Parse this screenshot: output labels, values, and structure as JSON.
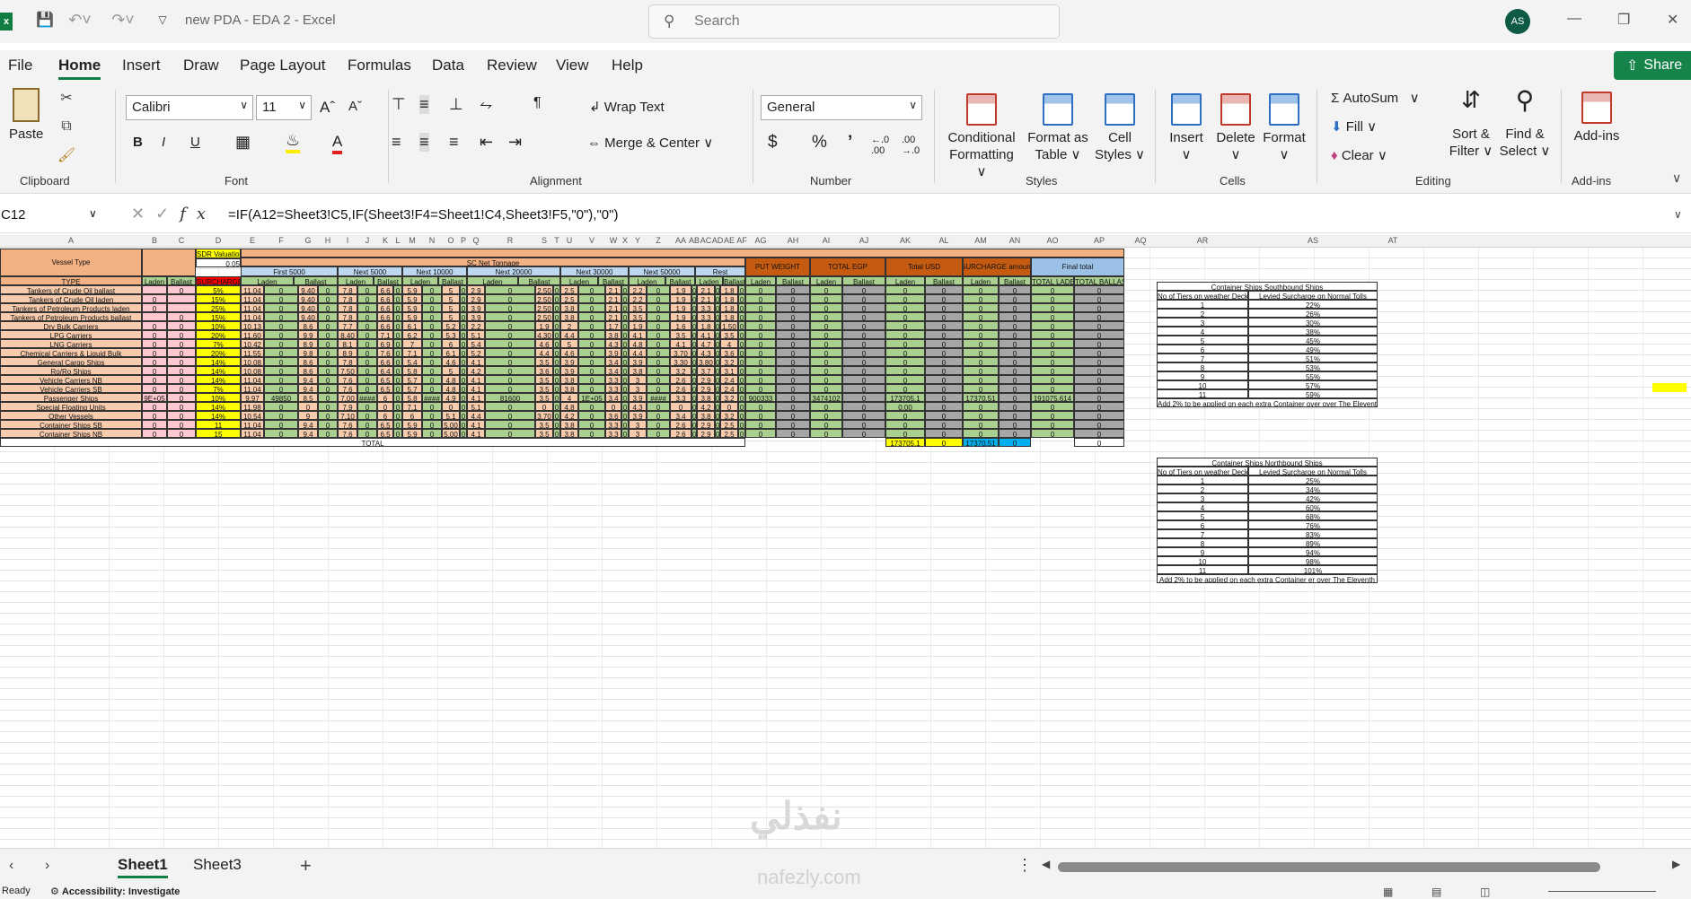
{
  "titlebar": {
    "autosave_label": "",
    "doc_title": "new PDA - EDA 2  -  Excel",
    "search_placeholder": "Search",
    "avatar": "AS"
  },
  "ribbon_tabs": [
    "File",
    "Home",
    "Insert",
    "Draw",
    "Page Layout",
    "Formulas",
    "Data",
    "Review",
    "View",
    "Help"
  ],
  "share_label": "Share",
  "clipboard": {
    "paste": "Paste",
    "group": "Clipboard"
  },
  "font": {
    "name": "Calibri",
    "size": "11",
    "group": "Font",
    "bold": "B",
    "italic": "I",
    "underline": "U"
  },
  "alignment": {
    "wrap": "Wrap Text",
    "merge": "Merge & Center",
    "group": "Alignment"
  },
  "number": {
    "format": "General",
    "group": "Number",
    "currency": "$",
    "percent": "%",
    "comma": "’"
  },
  "styles": {
    "cond": [
      "Conditional",
      "Formatting"
    ],
    "table": [
      "Format as",
      "Table"
    ],
    "cell": [
      "Cell",
      "Styles"
    ],
    "group": "Styles"
  },
  "cells": {
    "insert": "Insert",
    "delete": "Delete",
    "format": "Format",
    "group": "Cells"
  },
  "editing": {
    "autosum": "AutoSum",
    "fill": "Fill",
    "clear": "Clear",
    "sort": [
      "Sort &",
      "Filter"
    ],
    "find": [
      "Find &",
      "Select"
    ],
    "group": "Editing"
  },
  "addins": {
    "label": "Add-ins",
    "group": "Add-ins"
  },
  "formula_bar": {
    "cell_ref": "C12",
    "formula": "=IF(A12=Sheet3!C5,IF(Sheet3!F4=Sheet1!C4,Sheet3!F5,\"0\"),\"0\")"
  },
  "columns": [
    "A",
    "B",
    "C",
    "D",
    "E",
    "F",
    "G",
    "H",
    "I",
    "J",
    "K",
    "L",
    "M",
    "N",
    "O",
    "P",
    "Q",
    "R",
    "S",
    "T",
    "U",
    "V",
    "W",
    "X",
    "Y",
    "Z",
    "AA",
    "AB",
    "AC",
    "AD",
    "AE",
    "AF",
    "AG",
    "AH",
    "AI",
    "AJ",
    "AK",
    "AL",
    "AM",
    "AN",
    "AO",
    "AP",
    "AQ",
    "AR",
    "AS",
    "AT"
  ],
  "sheet": {
    "vessel_type": "Vessel Type",
    "sdr_label": "SDR Valuation",
    "sdr_value": "0.05",
    "sc_net": "SC Net Tonnage",
    "bands": [
      "First 5000",
      "Next 5000",
      "Next 10000",
      "Next 20000",
      "Next 30000",
      "Next 50000",
      "Rest"
    ],
    "right_heads": [
      "PUT WEIGHT",
      "TOTAL EGP",
      "Total USD",
      "SURCHARGE amount",
      "Final total"
    ],
    "type": "TYPE",
    "laden": "Laden",
    "ballast": "Ballast",
    "surcharge": "SURCHARGE",
    "total_laden": "TOTAL LADEN",
    "total_ballast": "TOTAL BALLAST",
    "total": "TOTAL",
    "rows": [
      {
        "name": "Tankers of Crude Oil ballast",
        "b": "",
        "c": "0",
        "d": "5%",
        "e": "11.04",
        "g": "9.40",
        "i": "7.8",
        "k": "6.6",
        "m": "5.9",
        "o": "5",
        "q": "2.9",
        "s": "2.50",
        "u": "2.5",
        "w": "2.1",
        "y": "2.2",
        "aa": "1.9",
        "ac": "2.1",
        "ae": "1.8"
      },
      {
        "name": "Tankers of Crude Oil laden",
        "b": "0",
        "c": "",
        "d": "15%",
        "e": "11.04",
        "g": "9.40",
        "i": "7.8",
        "k": "6.6",
        "m": "5.9",
        "o": "5",
        "q": "2.9",
        "s": "2.50",
        "u": "2.5",
        "w": "2.1",
        "y": "2.2",
        "aa": "1.9",
        "ac": "2.1",
        "ae": "1.8"
      },
      {
        "name": "Tankers of Petroleum Products laden",
        "b": "0",
        "c": "",
        "d": "25%",
        "e": "11.04",
        "g": "9.40",
        "i": "7.8",
        "k": "6.6",
        "m": "5.9",
        "o": "5",
        "q": "3.9",
        "s": "2.50",
        "u": "3.8",
        "w": "2.1",
        "y": "3.5",
        "aa": "1.9",
        "ac": "3.3",
        "ae": "1.8"
      },
      {
        "name": "Tankers of Petroleum Products ballast",
        "b": "",
        "c": "0",
        "d": "15%",
        "e": "11.04",
        "g": "9.40",
        "i": "7.8",
        "k": "6.6",
        "m": "5.9",
        "o": "5",
        "q": "3.9",
        "s": "2.50",
        "u": "3.8",
        "w": "2.1",
        "y": "3.5",
        "aa": "1.9",
        "ac": "3.3",
        "ae": "1.8"
      },
      {
        "name": "Dry Bulk Carriers",
        "b": "0",
        "c": "0",
        "d": "10%",
        "e": "10.13",
        "g": "8.6",
        "i": "7.7",
        "k": "6.6",
        "m": "6.1",
        "o": "5.2",
        "q": "2.2",
        "s": "1.9",
        "u": "2",
        "w": "1.7",
        "y": "1.9",
        "aa": "1.6",
        "ac": "1.8",
        "ae": "1.50"
      },
      {
        "name": "LPG Carriers",
        "b": "0",
        "c": "0",
        "d": "20%",
        "e": "11.60",
        "g": "9.9",
        "i": "8.40",
        "k": "7.1",
        "m": "6.2",
        "o": "5.3",
        "q": "5.1",
        "s": "4.30",
        "u": "4.4",
        "w": "3.8",
        "y": "4.1",
        "aa": "3.5",
        "ac": "4.1",
        "ae": "3.5"
      },
      {
        "name": "LNG Carriers",
        "b": "0",
        "c": "0",
        "d": "7%",
        "e": "10.42",
        "g": "8.9",
        "i": "8.1",
        "k": "6.9",
        "m": "7",
        "o": "6",
        "q": "5.4",
        "s": "4.6",
        "u": "5",
        "w": "4.3",
        "y": "4.8",
        "aa": "4.1",
        "ac": "4.7",
        "ae": "4"
      },
      {
        "name": "Chemical Carriers & Liquid Bulk",
        "b": "0",
        "c": "0",
        "d": "20%",
        "e": "11.55",
        "g": "9.8",
        "i": "8.9",
        "k": "7.6",
        "m": "7.1",
        "o": "6.1",
        "q": "5.2",
        "s": "4.4",
        "u": "4.6",
        "w": "3.9",
        "y": "4.4",
        "aa": "3.70",
        "ac": "4.3",
        "ae": "3.6"
      },
      {
        "name": "General Cargo Ships",
        "b": "0",
        "c": "0",
        "d": "14%",
        "e": "10.08",
        "g": "8.6",
        "i": "7.8",
        "k": "6.6",
        "m": "5.4",
        "o": "4.6",
        "q": "4.1",
        "s": "3.5",
        "u": "3.9",
        "w": "3.4",
        "y": "3.9",
        "aa": "3.30",
        "ac": "3.80",
        "ae": "3.2"
      },
      {
        "name": "Ro/Ro Ships",
        "b": "0",
        "c": "0",
        "d": "14%",
        "e": "10.08",
        "g": "8.6",
        "i": "7.50",
        "k": "6.4",
        "m": "5.8",
        "o": "5",
        "q": "4.2",
        "s": "3.6",
        "u": "3.9",
        "w": "3.4",
        "y": "3.8",
        "aa": "3.2",
        "ac": "3.7",
        "ae": "3.1"
      },
      {
        "name": "Vehicle Carriers NB",
        "b": "0",
        "c": "0",
        "d": "14%",
        "e": "11.04",
        "g": "9.4",
        "i": "7.6",
        "k": "6.5",
        "m": "5.7",
        "o": "4.8",
        "q": "4.1",
        "s": "3.5",
        "u": "3.8",
        "w": "3.3",
        "y": "3",
        "aa": "2.6",
        "ac": "2.9",
        "ae": "2.4"
      },
      {
        "name": "Vehicle Carriers SB",
        "b": "0",
        "c": "0",
        "d": "7%",
        "e": "11.04",
        "g": "9.4",
        "i": "7.6",
        "k": "6.5",
        "m": "5.7",
        "o": "4.8",
        "q": "4.1",
        "s": "3.5",
        "u": "3.8",
        "w": "3.3",
        "y": "3",
        "aa": "2.6",
        "ac": "2.9",
        "ae": "2.4"
      },
      {
        "name": "Passenger Ships",
        "b": "9E+05",
        "c": "0",
        "d": "10%",
        "e": "9.97",
        "f": "49850",
        "g": "8.5",
        "i": "7.00",
        "j": "####",
        "k": "6",
        "m": "5.8",
        "n": "####",
        "o": "4.9",
        "q": "4.1",
        "r": "81600",
        "s": "3.5",
        "u": "4",
        "v": "1E+05",
        "w": "3.4",
        "y": "3.9",
        "z": "####",
        "aa": "3.3",
        "ac": "3.8",
        "ae": "3.2",
        "ag": "900333",
        "ai": "3474102",
        "ak": "173705.1",
        "am": "17370.51",
        "ao": "191075.614"
      },
      {
        "name": "Special Floating Units",
        "b": "0",
        "c": "0",
        "d": "14%",
        "e": "11.98",
        "g": "0",
        "i": "7.9",
        "k": "0",
        "m": "7.1",
        "o": "0",
        "q": "5.1",
        "s": "0",
        "u": "4.8",
        "w": "0",
        "y": "4.3",
        "aa": "0",
        "ac": "4.2",
        "ae": "0",
        "ak": "0.00"
      },
      {
        "name": "Other Vessels",
        "b": "0",
        "c": "0",
        "d": "14%",
        "e": "10.54",
        "g": "9",
        "i": "7.10",
        "k": "6",
        "m": "6",
        "o": "5.1",
        "q": "4.4",
        "s": "3.70",
        "u": "4.2",
        "w": "3.6",
        "y": "3.9",
        "aa": "3.4",
        "ac": "3.8",
        "ae": "3.2"
      },
      {
        "name": "Container Ships SB",
        "b": "0",
        "c": "0",
        "d": "11",
        "e": "11.04",
        "g": "9.4",
        "i": "7.6",
        "k": "6.5",
        "m": "5.9",
        "o": "5.00",
        "q": "4.1",
        "s": "3.5",
        "u": "3.8",
        "w": "3.3",
        "y": "3",
        "aa": "2.6",
        "ac": "2.9",
        "ae": "2.5"
      },
      {
        "name": "Container Ships NB",
        "b": "0",
        "c": "0",
        "d": "15",
        "e": "11.04",
        "g": "9.4",
        "i": "7.6",
        "k": "6.5",
        "m": "5.9",
        "o": "5.00",
        "q": "4.1",
        "s": "3.5",
        "u": "3.8",
        "w": "3.3",
        "y": "3",
        "aa": "2.6",
        "ac": "2.9",
        "ae": "2.5"
      }
    ],
    "total_row": {
      "ak": "173705.1",
      "al": "0",
      "am": "17370.51",
      "an": "0",
      "ap": "0"
    }
  },
  "south": {
    "title": "Container Ships  Southbound Ships",
    "h1": "No of Tiers on weather Deck",
    "h2": "Levied Surcharge on Normal Tolls",
    "rows": [
      [
        "1",
        "22%"
      ],
      [
        "2",
        "26%"
      ],
      [
        "3",
        "30%"
      ],
      [
        "4",
        "38%"
      ],
      [
        "5",
        "45%"
      ],
      [
        "6",
        "49%"
      ],
      [
        "7",
        "51%"
      ],
      [
        "8",
        "53%"
      ],
      [
        "9",
        "55%"
      ],
      [
        "10",
        "57%"
      ],
      [
        "11",
        "59%"
      ]
    ],
    "note": "Add 2% to be applied on each extra Container over over The Eleventh"
  },
  "north": {
    "title": "Container Ships  Northbound Ships",
    "h1": "No of Tiers on weather Deck",
    "h2": "Levied Surcharge on Normal Tolls",
    "rows": [
      [
        "1",
        "25%"
      ],
      [
        "2",
        "34%"
      ],
      [
        "3",
        "42%"
      ],
      [
        "4",
        "60%"
      ],
      [
        "5",
        "68%"
      ],
      [
        "6",
        "76%"
      ],
      [
        "7",
        "83%"
      ],
      [
        "8",
        "89%"
      ],
      [
        "9",
        "94%"
      ],
      [
        "10",
        "98%"
      ],
      [
        "11",
        "101%"
      ]
    ],
    "note": "Add 2% to  be applied on each extra Container er over The Eleventh"
  },
  "sheets": [
    "Sheet1",
    "Sheet3"
  ],
  "status": {
    "ready": "Ready",
    "access": "Accessibility: Investigate"
  },
  "watermark": {
    "brand": "نفذلي",
    "url": "nafezly.com"
  }
}
